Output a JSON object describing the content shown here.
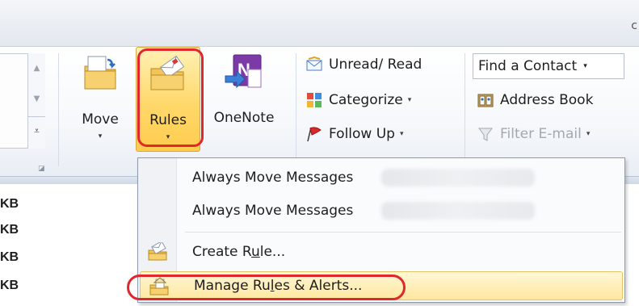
{
  "window": {
    "title_overflow": "c"
  },
  "ribbon": {
    "move": {
      "label": "Move",
      "caret": "▾"
    },
    "rules": {
      "label": "Rules",
      "caret": "▾"
    },
    "onenote": {
      "label": "OneNote"
    },
    "unread_read": {
      "label": "Unread/ Read"
    },
    "categorize": {
      "label": "Categorize",
      "caret": "▾"
    },
    "follow_up": {
      "label": "Follow Up",
      "caret": "▾"
    },
    "find_contact": {
      "label": "Find a Contact",
      "caret": "▾"
    },
    "address_book": {
      "label": "Address Book"
    },
    "filter_email": {
      "label": "Filter E-mail",
      "caret": "▾"
    }
  },
  "list_sizes": [
    "KB",
    "KB",
    "KB",
    "KB"
  ],
  "rules_menu": {
    "items": [
      {
        "label": "Always Move Messages",
        "has_icon": false
      },
      {
        "label": "Always Move Messages",
        "has_icon": false
      },
      {
        "label_pre": "Create R",
        "label_access": "u",
        "label_post": "le...",
        "has_icon": true
      },
      {
        "label_pre": "Manage Ru",
        "label_access": "l",
        "label_post": "es & Alerts...",
        "has_icon": true
      }
    ]
  },
  "colors": {
    "highlight_red": "#e0272b",
    "hover_gold": "#ffe7a0",
    "ribbon_bg": "#f6f8fb"
  }
}
